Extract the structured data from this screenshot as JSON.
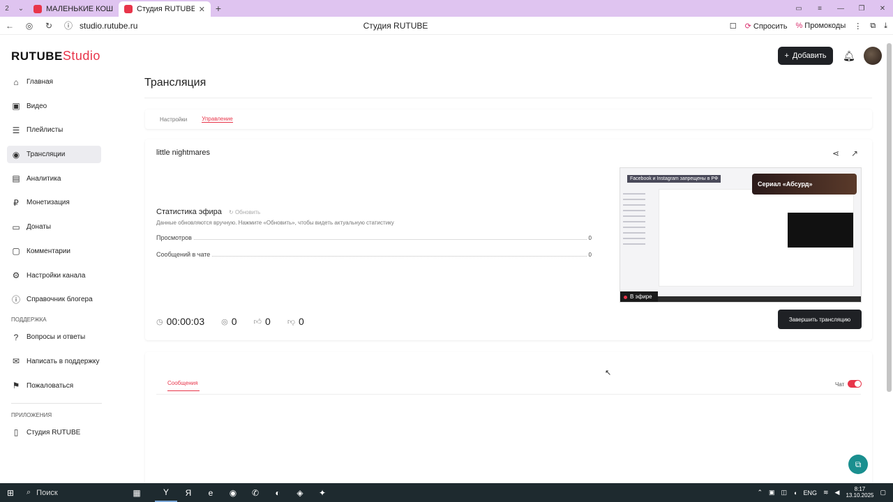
{
  "browser": {
    "tabs": [
      {
        "label": "2"
      },
      {
        "label": "МАЛЕНЬКИЕ КОШМАРИ"
      },
      {
        "label": "Студия RUTUBE"
      }
    ],
    "url": "studio.rutube.ru",
    "page_title": "Студия RUTUBE",
    "ask_label": "Спросить",
    "promo_label": "Промокоды"
  },
  "header": {
    "logo_main": "RUTUBE",
    "logo_sub": "Studio",
    "add_label": "Добавить"
  },
  "sidebar": {
    "items": [
      {
        "label": "Главная",
        "icon": "home-icon"
      },
      {
        "label": "Видео",
        "icon": "video-icon"
      },
      {
        "label": "Плейлисты",
        "icon": "playlist-icon"
      },
      {
        "label": "Трансляции",
        "icon": "broadcast-icon"
      },
      {
        "label": "Аналитика",
        "icon": "analytics-icon"
      },
      {
        "label": "Монетизация",
        "icon": "money-icon"
      },
      {
        "label": "Донаты",
        "icon": "donate-icon"
      },
      {
        "label": "Комментарии",
        "icon": "comments-icon"
      },
      {
        "label": "Настройки канала",
        "icon": "gear-icon"
      },
      {
        "label": "Справочник блогера",
        "icon": "info-icon"
      }
    ],
    "support_title": "ПОДДЕРЖКА",
    "support_items": [
      {
        "label": "Вопросы и ответы"
      },
      {
        "label": "Написать в поддержку"
      },
      {
        "label": "Пожаловаться"
      }
    ],
    "apps_title": "ПРИЛОЖЕНИЯ",
    "apps_items": [
      {
        "label": "Студия RUTUBE"
      }
    ]
  },
  "main": {
    "title": "Трансляция",
    "tabs": [
      {
        "label": "Настройки",
        "active": false
      },
      {
        "label": "Управление",
        "active": true
      }
    ],
    "stream_name": "little nightmares",
    "stats": {
      "title": "Статистика эфира",
      "refresh_label": "Обновить",
      "description": "Данные обновляются вручную. Нажмите «Обновить», чтобы видеть актуальную статистику",
      "rows": [
        {
          "label": "Просмотров",
          "value": "0"
        },
        {
          "label": "Сообщений в чате",
          "value": "0"
        }
      ]
    },
    "preview": {
      "banner": "Facebook и Instagram запрещены в РФ",
      "ad_label": "Сериал «Абсурд»",
      "live_label": "В эфире"
    },
    "metrics": {
      "duration": "00:00:03",
      "viewers": "0",
      "likes": "0",
      "dislikes": "0"
    },
    "end_button": "Завершить трансляцию",
    "chat": {
      "tab_label": "Сообщения",
      "toggle_label": "Чат",
      "toggle_on": true
    }
  },
  "taskbar": {
    "search_label": "Поиск",
    "lang": "ENG",
    "time": "8:17",
    "date": "13.10.2025"
  },
  "colors": {
    "accent": "#e8354a",
    "dark_button": "#1f2125",
    "help_fab": "#1a8f8f"
  }
}
